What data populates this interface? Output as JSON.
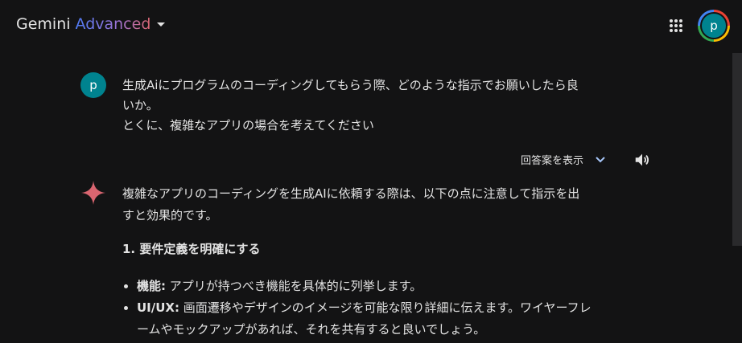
{
  "header": {
    "product_name": "Gemini",
    "product_tier": "Advanced",
    "avatar_initial": "p"
  },
  "user_message": {
    "avatar_initial": "p",
    "lines": [
      "生成Aiにプログラムのコーディングしてもらう際、どのような指示でお願いしたら良",
      "いか。",
      "とくに、複雑なアプリの場合を考えてください"
    ]
  },
  "response_controls": {
    "show_drafts_label": "回答案を表示"
  },
  "response": {
    "intro_lines": [
      "複雑なアプリのコーディングを生成AIに依頼する際は、以下の点に注意して指示を出",
      "すと効果的です。"
    ],
    "section_heading": "1. 要件定義を明確にする",
    "bullets": [
      {
        "term": "機能:",
        "lines": [
          "アプリが持つべき機能を具体的に列挙します。"
        ]
      },
      {
        "term": "UI/UX:",
        "lines": [
          "画面遷移やデザインのイメージを可能な限り詳細に伝えます。ワイヤーフレ",
          "ームやモックアップがあれば、それを共有すると良いでしょう。"
        ]
      }
    ]
  },
  "colors": {
    "background": "#131314",
    "text": "#e3e3e3",
    "avatar": "#00838f",
    "gemini_star": "#d96570"
  }
}
